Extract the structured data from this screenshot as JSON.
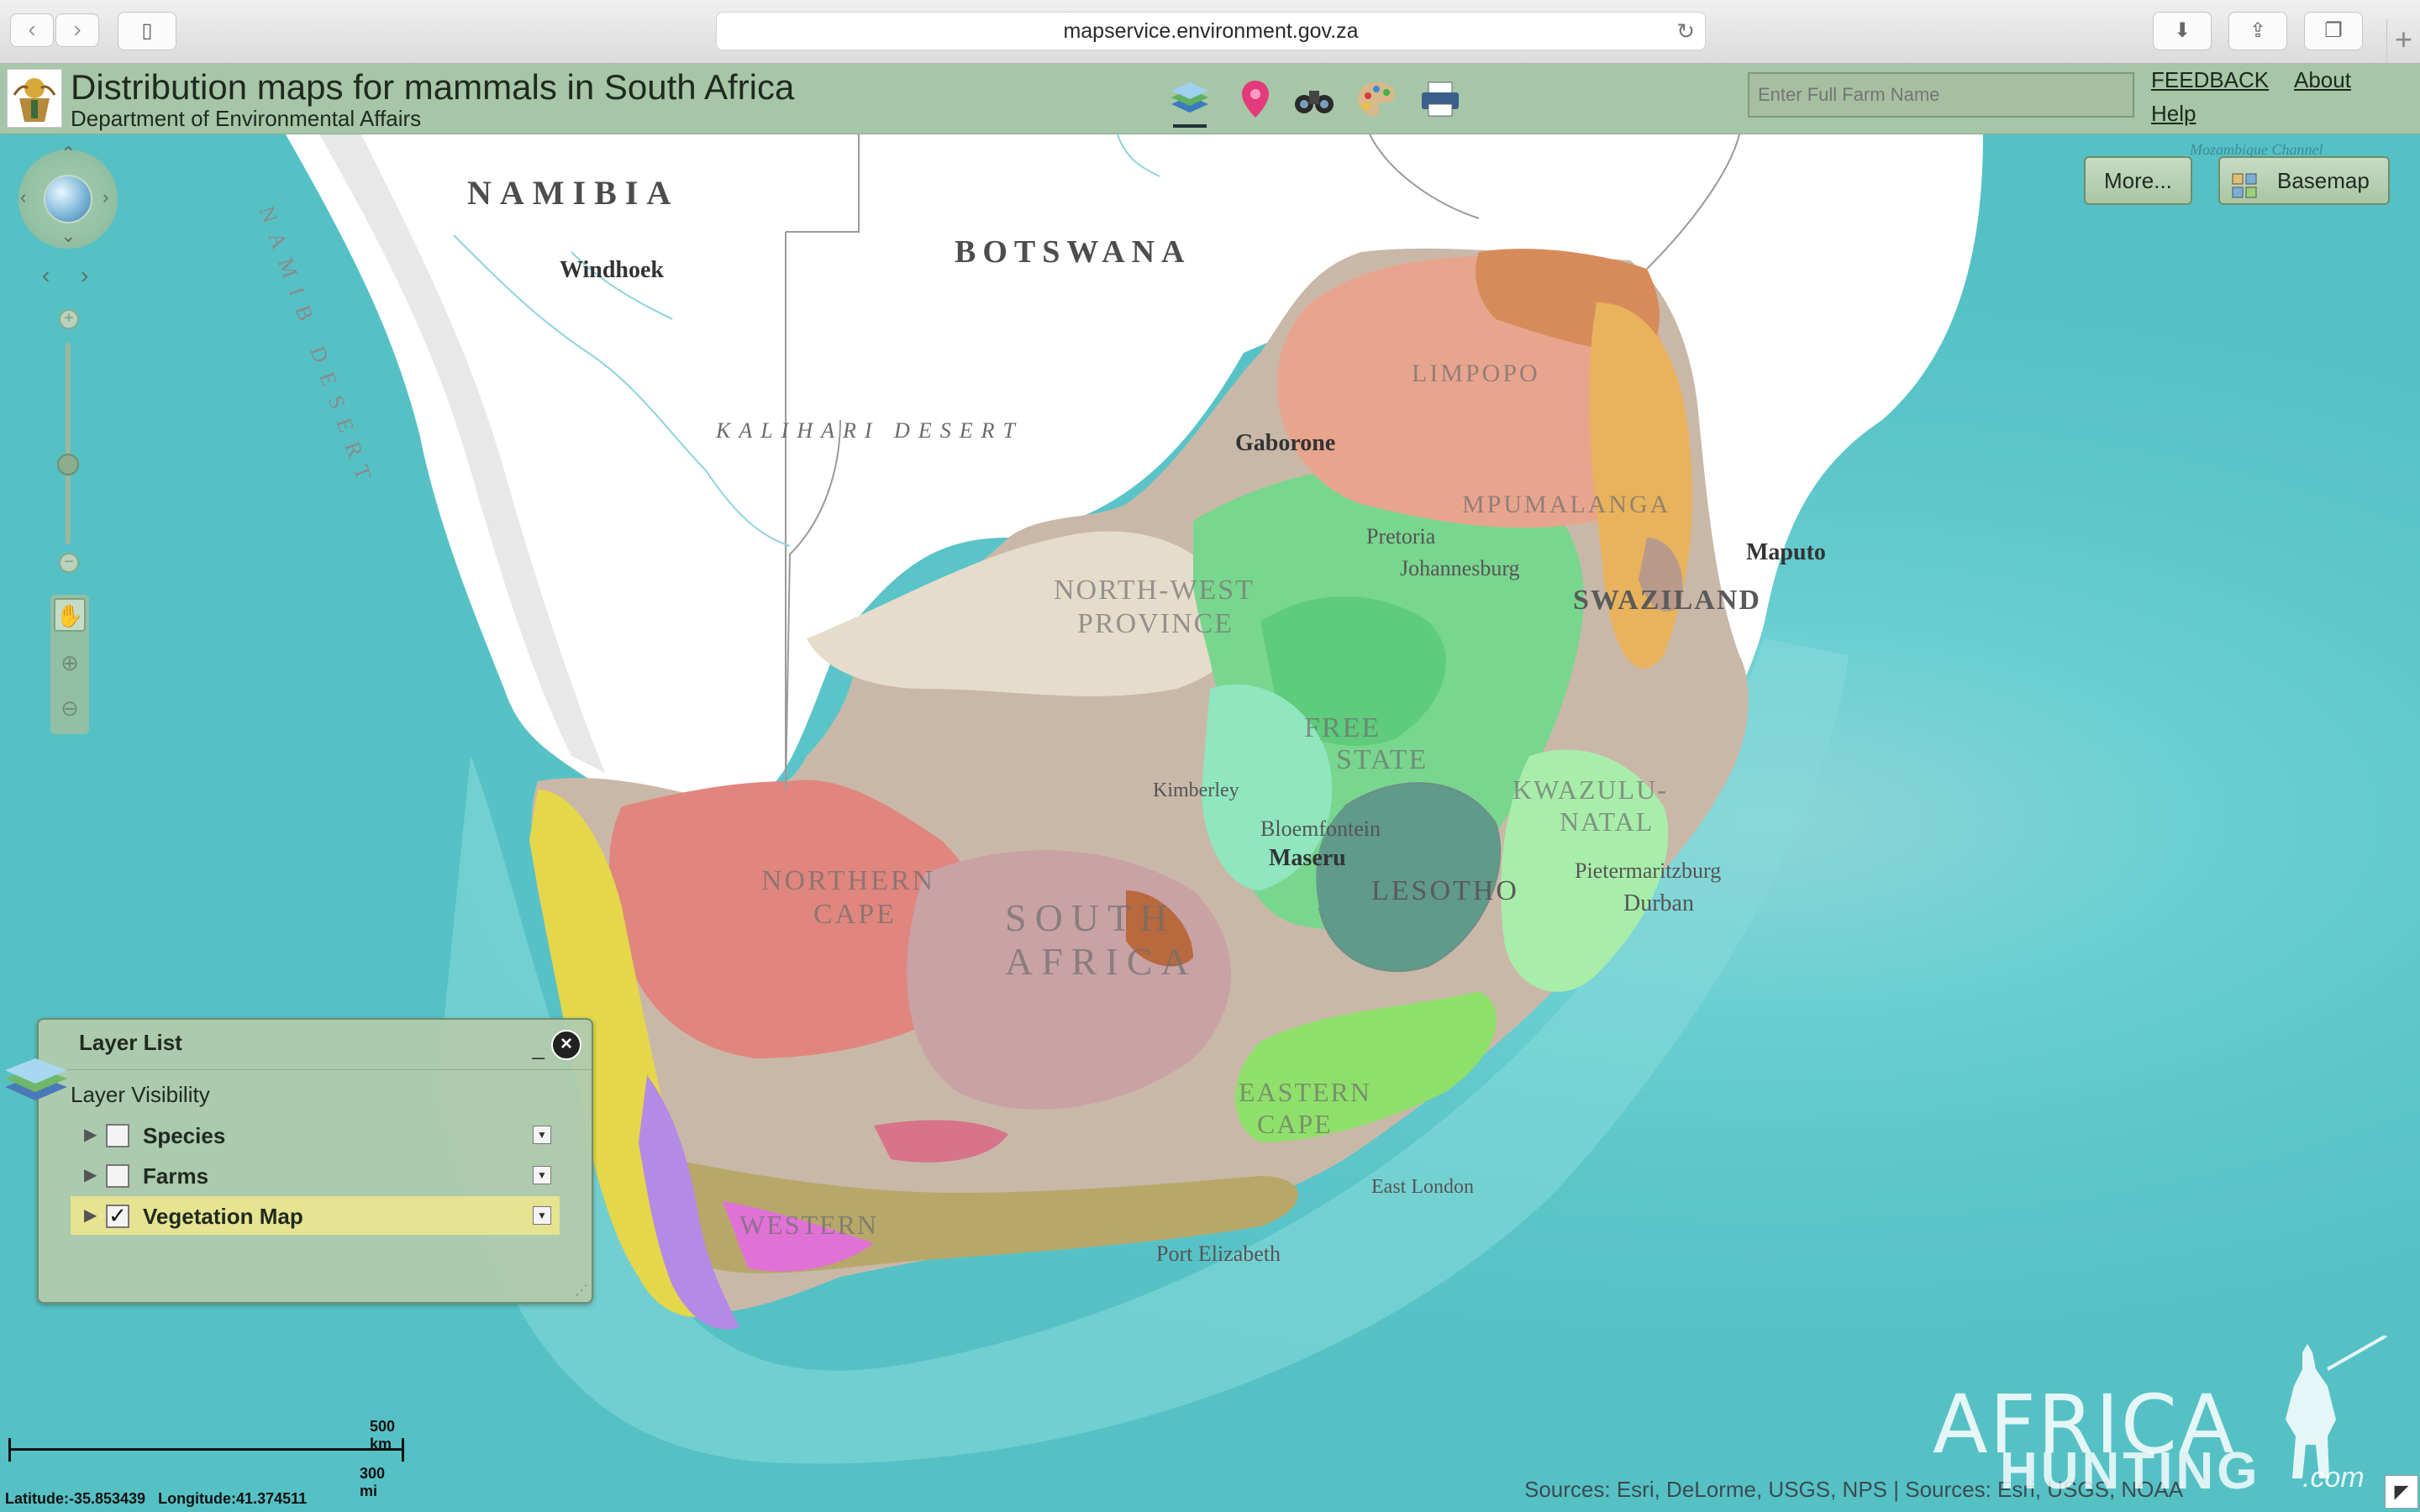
{
  "browser": {
    "url": "mapservice.environment.gov.za",
    "back_icon": "chevron-left-icon",
    "forward_icon": "chevron-right-icon"
  },
  "app": {
    "title": "Distribution maps for mammals in South Africa",
    "subtitle": "Department of Environmental Affairs",
    "search_placeholder": "Enter Full Farm Name",
    "links": {
      "feedback": "FEEDBACK",
      "about": "About",
      "help": "Help"
    },
    "toolbar_icons": [
      "layers-icon",
      "location-pin-icon",
      "binoculars-icon",
      "palette-icon",
      "print-icon"
    ]
  },
  "map": {
    "buttons": {
      "more": "More...",
      "basemap": "Basemap"
    },
    "labels": {
      "namibia": "NAMIBIA",
      "botswana": "BOTSWANA",
      "kalahari": "KALIHARI DESERT",
      "windhoek": "Windhoek",
      "gaborone": "Gaborone",
      "maputo": "Maputo",
      "pretoria": "Pretoria",
      "johannesburg": "Johannesburg",
      "swaziland": "SWAZILAND",
      "limpopo": "LIMPOPO",
      "mpumalanga": "MPUMALANGA",
      "north_west_1": "NORTH-WEST",
      "north_west_2": "PROVINCE",
      "free_state_1": "FREE",
      "free_state_2": "STATE",
      "kimberley": "Kimberley",
      "bloemfontein": "Bloemfontein",
      "maseru": "Maseru",
      "lesotho": "LESOTHO",
      "kwazulu_1": "KWAZULU-",
      "kwazulu_2": "NATAL",
      "pietermaritzburg": "Pietermaritzburg",
      "durban": "Durban",
      "northern_cape_1": "NORTHERN",
      "northern_cape_2": "CAPE",
      "south_africa_1": "SOUTH",
      "south_africa_2": "AFRICA",
      "eastern_cape_1": "EASTERN",
      "eastern_cape_2": "CAPE",
      "east_london": "East London",
      "port_elizabeth": "Port Elizabeth",
      "western_cape": "WESTERN",
      "namib_desert": "NAMIB DESERT",
      "mozambique_channel": "Mozambique Channel"
    },
    "scale": {
      "km": "500 km",
      "mi": "300 mi"
    },
    "coords": "Latitude:-35.853439   Longitude:41.374511",
    "sources": "Sources: Esri, DeLorme, USGS, NPS | Sources: Esri, USGS, NOAA"
  },
  "layer_list": {
    "title": "Layer List",
    "section": "Layer Visibility",
    "layers": [
      {
        "name": "Species",
        "checked": false
      },
      {
        "name": "Farms",
        "checked": false
      },
      {
        "name": "Vegetation Map",
        "checked": true
      }
    ]
  },
  "watermark": {
    "line1": "AFRICA",
    "line2": "HUNTING",
    "suffix": ".com"
  }
}
